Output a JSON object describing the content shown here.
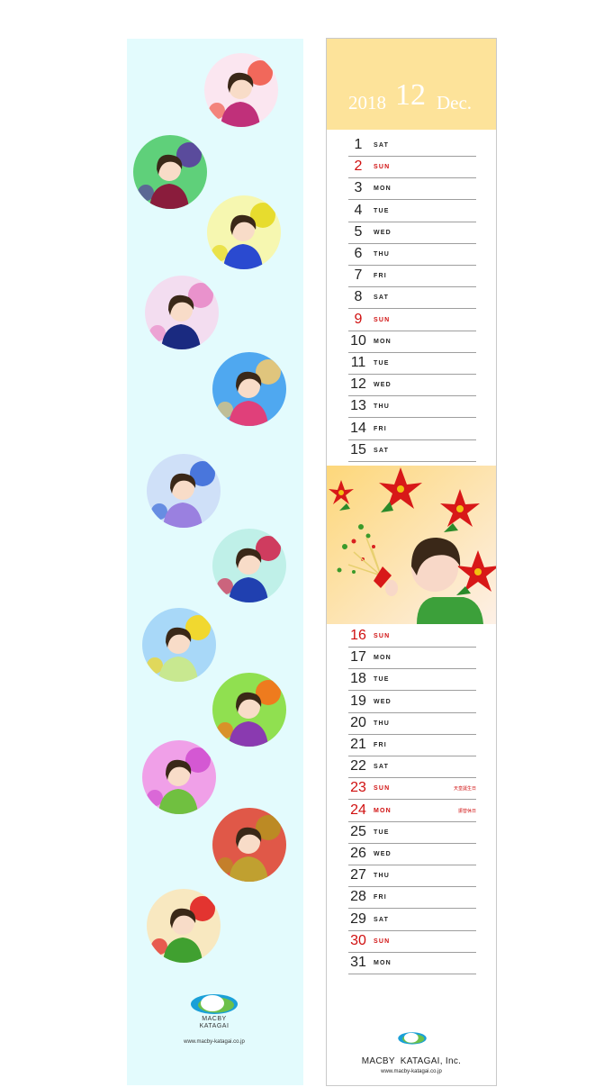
{
  "left": {
    "brand": "MACBY\nKATAGAI",
    "url": "www.macby-katagai.co.jp"
  },
  "header": {
    "year": "2018",
    "month": "12",
    "month_name": "Dec."
  },
  "rows_top": [
    {
      "day": "1",
      "dow": "SAT",
      "red": false,
      "note": ""
    },
    {
      "day": "2",
      "dow": "SUN",
      "red": true,
      "note": ""
    },
    {
      "day": "3",
      "dow": "MON",
      "red": false,
      "note": ""
    },
    {
      "day": "4",
      "dow": "TUE",
      "red": false,
      "note": ""
    },
    {
      "day": "5",
      "dow": "WED",
      "red": false,
      "note": ""
    },
    {
      "day": "6",
      "dow": "THU",
      "red": false,
      "note": ""
    },
    {
      "day": "7",
      "dow": "FRI",
      "red": false,
      "note": ""
    },
    {
      "day": "8",
      "dow": "SAT",
      "red": false,
      "note": ""
    },
    {
      "day": "9",
      "dow": "SUN",
      "red": true,
      "note": ""
    },
    {
      "day": "10",
      "dow": "MON",
      "red": false,
      "note": ""
    },
    {
      "day": "11",
      "dow": "TUE",
      "red": false,
      "note": ""
    },
    {
      "day": "12",
      "dow": "WED",
      "red": false,
      "note": ""
    },
    {
      "day": "13",
      "dow": "THU",
      "red": false,
      "note": ""
    },
    {
      "day": "14",
      "dow": "FRI",
      "red": false,
      "note": ""
    },
    {
      "day": "15",
      "dow": "SAT",
      "red": false,
      "note": ""
    }
  ],
  "rows_bottom": [
    {
      "day": "16",
      "dow": "SUN",
      "red": true,
      "note": ""
    },
    {
      "day": "17",
      "dow": "MON",
      "red": false,
      "note": ""
    },
    {
      "day": "18",
      "dow": "TUE",
      "red": false,
      "note": ""
    },
    {
      "day": "19",
      "dow": "WED",
      "red": false,
      "note": ""
    },
    {
      "day": "20",
      "dow": "THU",
      "red": false,
      "note": ""
    },
    {
      "day": "21",
      "dow": "FRI",
      "red": false,
      "note": ""
    },
    {
      "day": "22",
      "dow": "SAT",
      "red": false,
      "note": ""
    },
    {
      "day": "23",
      "dow": "SUN",
      "red": true,
      "note": "天皇誕生日"
    },
    {
      "day": "24",
      "dow": "MON",
      "red": true,
      "note": "振替休日"
    },
    {
      "day": "25",
      "dow": "TUE",
      "red": false,
      "note": ""
    },
    {
      "day": "26",
      "dow": "WED",
      "red": false,
      "note": ""
    },
    {
      "day": "27",
      "dow": "THU",
      "red": false,
      "note": ""
    },
    {
      "day": "28",
      "dow": "FRI",
      "red": false,
      "note": ""
    },
    {
      "day": "29",
      "dow": "SAT",
      "red": false,
      "note": ""
    },
    {
      "day": "30",
      "dow": "SUN",
      "red": true,
      "note": ""
    },
    {
      "day": "31",
      "dow": "MON",
      "red": false,
      "note": ""
    }
  ],
  "footer": {
    "brand": "MACBY  KATAGAI, Inc.",
    "url": "www.macby-katagai.co.jp"
  },
  "colors": {
    "header_bg": "#fde39a",
    "strip_bg": "#e3fbfd",
    "holiday": "#d01010",
    "logo_blue": "#1aa0d8",
    "logo_green": "#6cc04a"
  },
  "circles": [
    {
      "name": "woman-camellia",
      "bg": "#fbe6f0",
      "accent": "#f05a4a",
      "figure": "#c0307a"
    },
    {
      "name": "woman-pansies",
      "bg": "#5fd07a",
      "accent": "#5a3ca0",
      "figure": "#8a1c3c"
    },
    {
      "name": "legs-rapeseed",
      "bg": "#f6f7b0",
      "accent": "#e6d820",
      "figure": "#2a4ad0"
    },
    {
      "name": "man-cherry",
      "bg": "#f3ddf0",
      "accent": "#e88ac8",
      "figure": "#1a2a80"
    },
    {
      "name": "woman-hat",
      "bg": "#4fa8f0",
      "accent": "#f0c870",
      "figure": "#e0407a"
    },
    {
      "name": "woman-umbrella",
      "bg": "#cfe0f8",
      "accent": "#3a6ad8",
      "figure": "#9a80e0"
    },
    {
      "name": "woman-poppy",
      "bg": "#bff0e8",
      "accent": "#d02850",
      "figure": "#2040b0"
    },
    {
      "name": "sleeping-sunflower",
      "bg": "#a8d8f8",
      "accent": "#f8d818",
      "figure": "#c8e890"
    },
    {
      "name": "curtain-window",
      "bg": "#90e050",
      "accent": "#f87018",
      "figure": "#8a3ab0"
    },
    {
      "name": "woman-cosmos",
      "bg": "#f0a0e8",
      "accent": "#d050d0",
      "figure": "#70c040"
    },
    {
      "name": "woman-tea",
      "bg": "#e05848",
      "accent": "#b89020",
      "figure": "#c0a030"
    },
    {
      "name": "poinsettia-person",
      "bg": "#f8e8c0",
      "accent": "#e02020",
      "figure": "#40a030"
    }
  ]
}
